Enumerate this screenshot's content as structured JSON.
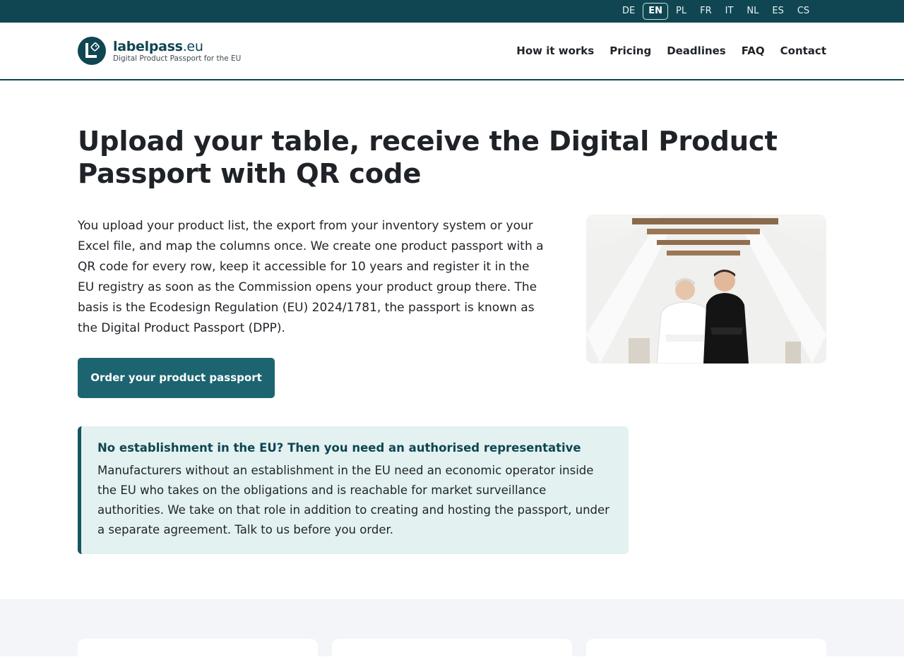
{
  "languages": [
    {
      "code": "DE",
      "active": false
    },
    {
      "code": "EN",
      "active": true
    },
    {
      "code": "PL",
      "active": false
    },
    {
      "code": "FR",
      "active": false
    },
    {
      "code": "IT",
      "active": false
    },
    {
      "code": "NL",
      "active": false
    },
    {
      "code": "ES",
      "active": false
    },
    {
      "code": "CS",
      "active": false
    }
  ],
  "brand": {
    "name": "labelpass",
    "tld": ".eu",
    "tagline": "Digital Product Passport for the EU",
    "logo_icon": "tag-icon"
  },
  "nav": [
    "How it works",
    "Pricing",
    "Deadlines",
    "FAQ",
    "Contact"
  ],
  "hero": {
    "title": "Upload your table, receive the Digital Product Passport with QR code",
    "intro": "You upload your product list, the export from your inventory system or your Excel file, and map the columns once. We create one product passport with a QR code for every row, keep it accessible for 10 years and register it in the EU registry as soon as the Commission opens your product group there. The basis is the Ecodesign Regulation (EU) 2024/1781, the passport is known as the Digital Product Passport (DPP).",
    "cta_label": "Order your product passport"
  },
  "notice": {
    "title": "No establishment in the EU? Then you need an authorised representative",
    "body": "Manufacturers without an establishment in the EU need an economic operator inside the EU who takes on the obligations and is reachable for market surveillance authorities. We take on that role in addition to creating and hosting the passport, under a separate agreement. Talk to us before you order."
  },
  "colors": {
    "brand_dark": "#0f4652",
    "button": "#1c6470",
    "notice_bg": "#e4f1f1",
    "band_bg": "#f3f5f8"
  }
}
